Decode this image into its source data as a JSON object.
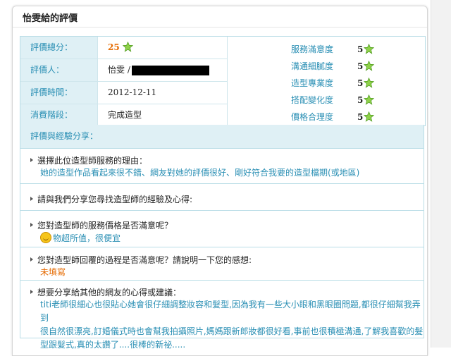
{
  "panel": {
    "title": "怡雯給的評價"
  },
  "summary": {
    "rows": [
      {
        "label": "評價總分：",
        "value": "25"
      },
      {
        "label": "評價人：",
        "value": "怡雯 /"
      },
      {
        "label": "評價時間：",
        "value": "2012-12-11"
      },
      {
        "label": "消費階段：",
        "value": "完成造型"
      }
    ],
    "ratings": [
      {
        "name": "服務滿意度",
        "score": "5"
      },
      {
        "name": "溝通細膩度",
        "score": "5"
      },
      {
        "name": "造型專業度",
        "score": "5"
      },
      {
        "name": "搭配變化度",
        "score": "5"
      },
      {
        "name": "價格合理度",
        "score": "5"
      }
    ]
  },
  "share": {
    "heading": "評價與經驗分享：",
    "q1": "選擇此位造型師服務的理由：",
    "a1": "她的造型作品看起來很不錯、網友對她的評價很好、剛好符合我要的造型檔期(或地區)",
    "q2": "請與我們分享您尋找造型師的經驗及心得:",
    "q3": "您對造型師的服務價格是否滿意呢？",
    "a3": "物超所值，很便宜",
    "q4": "您對造型師回覆的過程是否滿意呢？請說明一下您的感想:",
    "a4": "未填寫",
    "q5": "想要分享給其他的網友的心得或建議：",
    "a5_line1": "titi老師很細心也很貼心她會很仔細調整妝容和髮型,因為我有一些大小眼和黑眼圈問題,都很仔細幫我弄到",
    "a5_line2": "很自然很漂亮,訂婚儀式時也會幫我拍攝照片,媽媽跟新郎妝都很好看,事前也很積極溝通,了解我喜歡的髮",
    "a5_line3": "型跟髮式,真的太讚了....很棒的新祕....."
  },
  "colors": {
    "accent": "#2a8fb4",
    "label_bg": "#dff0f5",
    "highlight": "#e56a00"
  }
}
